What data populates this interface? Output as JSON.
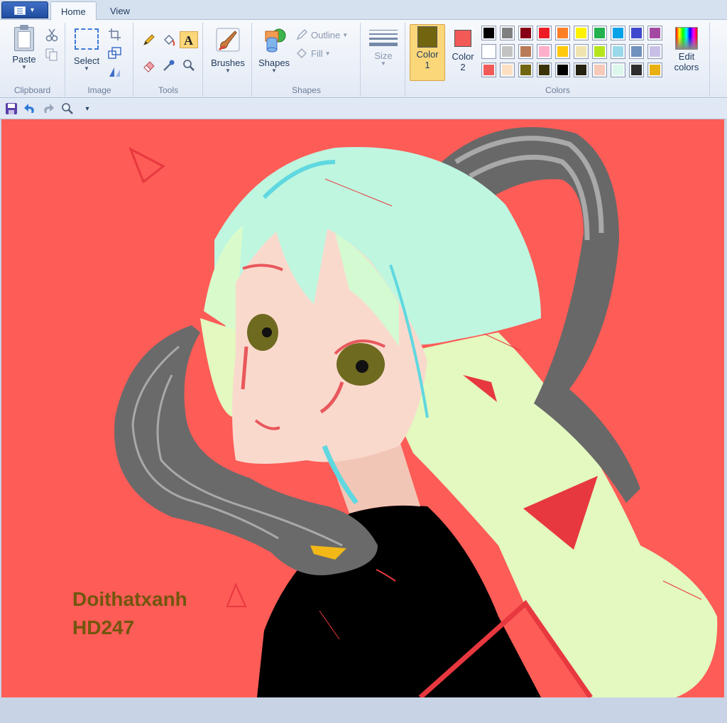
{
  "tabs": {
    "app_menu_icon": "paint-menu-icon",
    "home": "Home",
    "view": "View"
  },
  "clipboard": {
    "paste": "Paste",
    "group_label": "Clipboard"
  },
  "image": {
    "select": "Select",
    "group_label": "Image"
  },
  "tools": {
    "group_label": "Tools",
    "active_tool": "text-tool"
  },
  "brushes": {
    "label": "Brushes"
  },
  "shapes": {
    "label": "Shapes",
    "outline": "Outline",
    "fill": "Fill",
    "group_label": "Shapes"
  },
  "size": {
    "label": "Size"
  },
  "colors": {
    "color1_label": "Color\n1",
    "color1_line1": "Color",
    "color1_line2": "1",
    "color2_line1": "Color",
    "color2_line2": "2",
    "color1_value": "#726510",
    "color2_value": "#f25a58",
    "group_label": "Colors",
    "edit_line1": "Edit",
    "edit_line2": "colors",
    "palette": [
      [
        "#000000",
        "#7f7f7f",
        "#880015",
        "#ed1c24",
        "#ff7f27",
        "#fff200",
        "#22b14c",
        "#00a2e8",
        "#3f48cc",
        "#a349a4"
      ],
      [
        "#ffffff",
        "#c3c3c3",
        "#b97a57",
        "#ffaec9",
        "#ffc90e",
        "#efe4b0",
        "#b5e61d",
        "#99d9ea",
        "#7092be",
        "#c8bfe7"
      ],
      [
        "#f25a58",
        "#fde0c4",
        "#726510",
        "#3a3308",
        "#000000",
        "#262210",
        "#f7c9b8",
        "#dcf7ec",
        "#2e2e2e",
        "#e8b010"
      ]
    ]
  },
  "quick_access": {
    "save": "save-icon",
    "undo": "undo-icon",
    "redo": "redo-icon",
    "zoom": "zoom-icon",
    "customize": "customize-dropdown-icon"
  },
  "canvas": {
    "background": "#fd5c57",
    "signature_line1": "Doithatxanh",
    "signature_line2": "HD247"
  }
}
